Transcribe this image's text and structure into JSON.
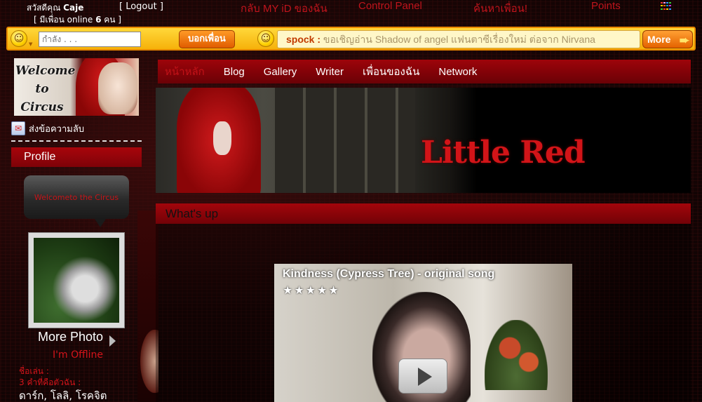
{
  "topbar": {
    "greeting": "สวัสดีคุณ",
    "username": "Caje",
    "logout": "[ Logout ]",
    "online_prefix": "[ มีเพื่อน online",
    "online_count": "6",
    "online_suffix": "คน ]",
    "links": [
      "กลับ MY iD ของฉัน",
      "Control Panel",
      "ค้นหาเพื่อน!",
      "Points"
    ]
  },
  "socialbar": {
    "status_placeholder": "กำลัง . . .",
    "tell_friends": "บอกเพื่อน",
    "ticker_name": "spock :",
    "ticker_message": "ขอเชิญอ่าน Shadow of angel แฟนตาซีเรื่องใหม่ ต่อจาก Nirvana",
    "more": "More"
  },
  "sidebar": {
    "welcome": "Welcome to Circus",
    "send_message": "ส่งข้อความลับ",
    "profile_heading": "Profile",
    "speech": "Welcometo the Circus",
    "more_photo": "More Photo",
    "status": "I'm Offline",
    "label_nickname": "ชื่อเล่น :",
    "label_words": "3 คำที่คือตัวฉัน :",
    "words_value": "ดาร์ก, โลลิ, โรคจิต"
  },
  "nav": {
    "items": [
      "หน้าหลัก",
      "Blog",
      "Gallery",
      "Writer",
      "เพื่อนของฉัน",
      "Network"
    ],
    "active_index": 0
  },
  "header": {
    "title": "Little Red"
  },
  "whatsup": {
    "heading": "What's up"
  },
  "video": {
    "title": "Kindness (Cypress Tree) - original song",
    "stars": "★★★★★",
    "rating": 5
  }
}
